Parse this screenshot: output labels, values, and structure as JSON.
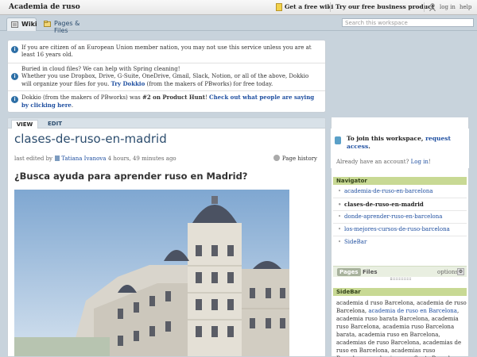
{
  "topbar": {
    "site_title": "Academia de ruso",
    "get_wiki": "Get a free wiki",
    "business": "Try our free business product",
    "login": "log in",
    "help": "help"
  },
  "tabs": {
    "wiki": "Wiki",
    "pages_files": "Pages & Files"
  },
  "search": {
    "placeholder": "Search this workspace"
  },
  "notices": {
    "n1": "If you are citizen of an European Union member nation, you may not use this service unless you are at least 16 years old.",
    "n2_line1": "Buried in cloud files? We can help with Spring cleaning!",
    "n2_line2": "Whether you use Dropbox, Drive, G-Suite, OneDrive, Gmail, Slack, Notion, or all of the above, Dokkio will organize your files for you.",
    "n2_link": "Try Dokkio",
    "n2_tail": "(from the makers of PBworks) for free today.",
    "n3_pre": "Dokkio (from the makers of PBworks) was",
    "n3_bold": "#2 on Product Hunt",
    "n3_mid": "!",
    "n3_link": "Check out what people are saying by clicking here",
    "n3_end": "."
  },
  "page": {
    "tab_view": "VIEW",
    "tab_edit": "EDIT",
    "title": "clases-de-ruso-en-madrid",
    "edited_by": "last edited by",
    "editor": "Tatiana Ivanova",
    "edited_when": "4 hours, 49 minutes ago",
    "history": "Page history",
    "heading": "¿Busca ayuda para aprender ruso en Madrid?"
  },
  "join": {
    "pre": "To join this workspace,",
    "link": "request access",
    "end": ".",
    "already": "Already have an account?",
    "login": "Log in",
    "bang": "!"
  },
  "navigator": {
    "title": "Navigator",
    "items": [
      "academia-de-ruso-en-barcelona",
      "clases-de-ruso-en-madrid",
      "donde-aprender-ruso-en-barcelona",
      "los-mejores-cursos-de-ruso-barcelona",
      "SideBar"
    ],
    "pages": "Pages",
    "files": "Files",
    "options": "options"
  },
  "sidebar": {
    "title": "SideBar",
    "t1": "academia d ruso Barcelona, academia de ruso Barcelona,",
    "link": "academia de ruso en Barcelona",
    "t2": ", academia ruso barata Barcelona, academia ruso Barcelona, academia ruso Barcelona barata, academia ruso en Barcelona, academias de ruso Barcelona, academias de ruso en Barcelona, academias ruso Barcelona, academias ruso Sants Barcelona, academias ruso en Barcelona"
  },
  "colors": {
    "title_blue": "#2c4d6e",
    "link_blue": "#1f4fa0",
    "panel_green": "#c8d994"
  },
  "icons": [
    "wiki-star-icon",
    "user-icon",
    "wiki-tab-icon",
    "pages-tab-icon",
    "info-icon",
    "editor-icon",
    "history-icon",
    "join-icon",
    "gear-icon"
  ]
}
